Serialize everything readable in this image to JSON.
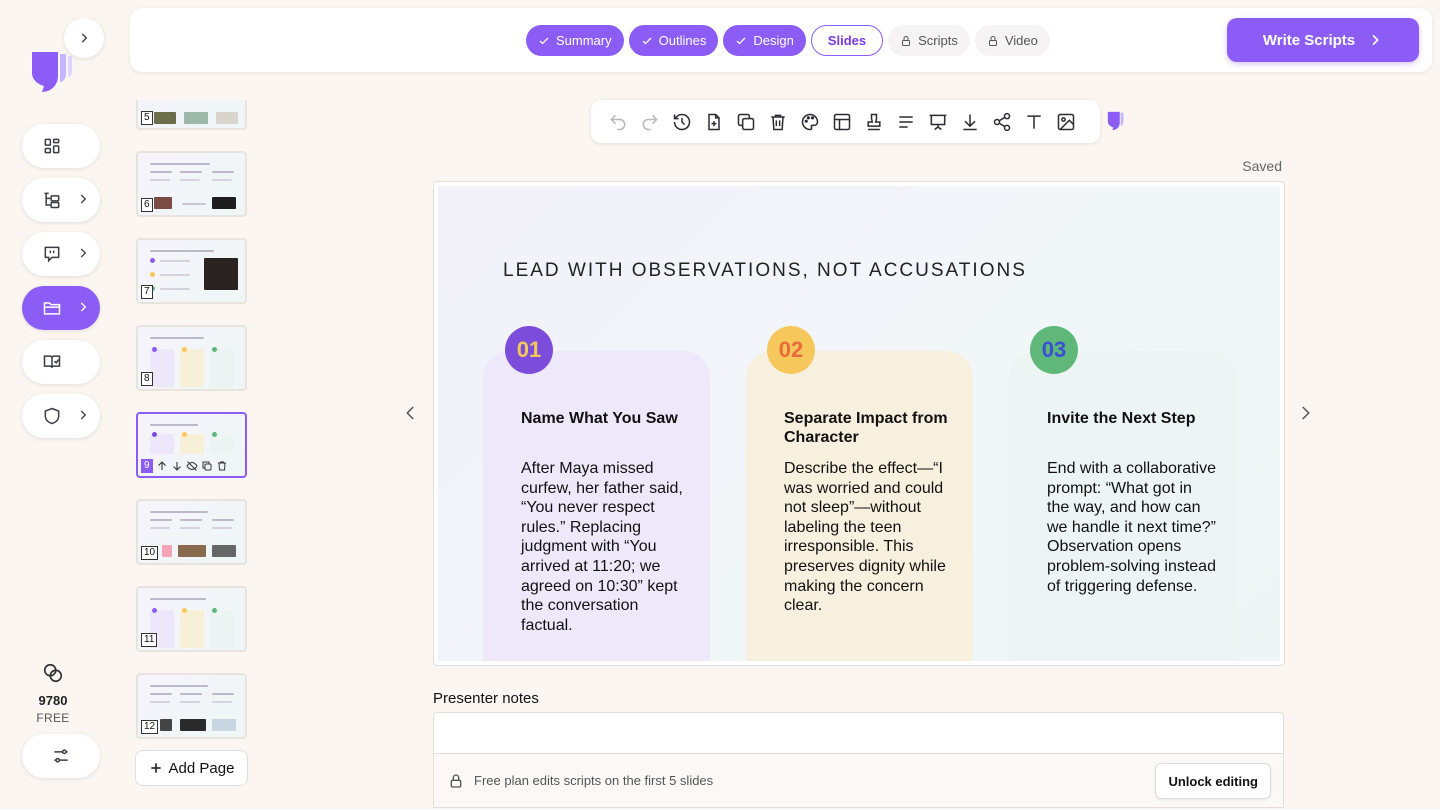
{
  "header": {
    "steps": [
      {
        "label": "Summary",
        "state": "done"
      },
      {
        "label": "Outlines",
        "state": "done"
      },
      {
        "label": "Design",
        "state": "done"
      },
      {
        "label": "Slides",
        "state": "current"
      },
      {
        "label": "Scripts",
        "state": "locked"
      },
      {
        "label": "Video",
        "state": "locked"
      }
    ],
    "write_scripts_label": "Write Scripts"
  },
  "sidebar": {
    "credits": "9780",
    "plan": "FREE",
    "items": [
      {
        "icon": "grid-icon",
        "has_submenu": false,
        "active": false
      },
      {
        "icon": "tree-icon",
        "has_submenu": true,
        "active": false
      },
      {
        "icon": "chat-icon",
        "has_submenu": true,
        "active": false
      },
      {
        "icon": "folder-icon",
        "has_submenu": true,
        "active": true
      },
      {
        "icon": "book-icon",
        "has_submenu": false,
        "active": false
      },
      {
        "icon": "shield-icon",
        "has_submenu": true,
        "active": false
      }
    ]
  },
  "thumbnails": {
    "numbers": [
      "5",
      "6",
      "7",
      "8",
      "9",
      "10",
      "11",
      "12"
    ],
    "selected": "9",
    "add_page_label": "Add Page"
  },
  "toolbar": {
    "icons": [
      "undo-icon",
      "redo-icon",
      "history-icon",
      "add-page-icon",
      "duplicate-icon",
      "delete-icon",
      "palette-icon",
      "layout-icon",
      "stamp-icon",
      "align-icon",
      "present-icon",
      "download-icon",
      "share-icon",
      "text-icon",
      "image-icon"
    ],
    "save_status": "Saved"
  },
  "slide": {
    "title": "LEAD WITH OBSERVATIONS, NOT ACCUSATIONS",
    "cards": [
      {
        "number": "01",
        "heading": "Name What You Saw",
        "body": "After Maya missed curfew, her father said, “You never respect rules.” Replacing judgment with “You arrived at 11:20; we agreed on 10:30” kept the conversation factual.",
        "badge_color": "#7c4ddb",
        "badge_text_color": "#f3c85a",
        "card_color": "#ede9fb"
      },
      {
        "number": "02",
        "heading": "Separate Impact from Character",
        "body": "Describe the effect—“I was worried and could not sleep”—without labeling the teen irresponsible. This preserves dignity while making the concern clear.",
        "badge_color": "#f6c85c",
        "badge_text_color": "#e96a3a",
        "card_color": "#f8f0de"
      },
      {
        "number": "03",
        "heading": "Invite the Next Step",
        "body": "End with a collaborative prompt: “What got in the way, and how can we handle it next time?” Observation opens problem-solving instead of triggering defense.",
        "badge_color": "#5fb87a",
        "badge_text_color": "#3a4fd6",
        "card_color": "#edf4f4"
      }
    ]
  },
  "notes": {
    "label": "Presenter notes",
    "value": "",
    "lock_message": "Free plan edits scripts on the first 5 slides",
    "unlock_label": "Unlock editing"
  }
}
